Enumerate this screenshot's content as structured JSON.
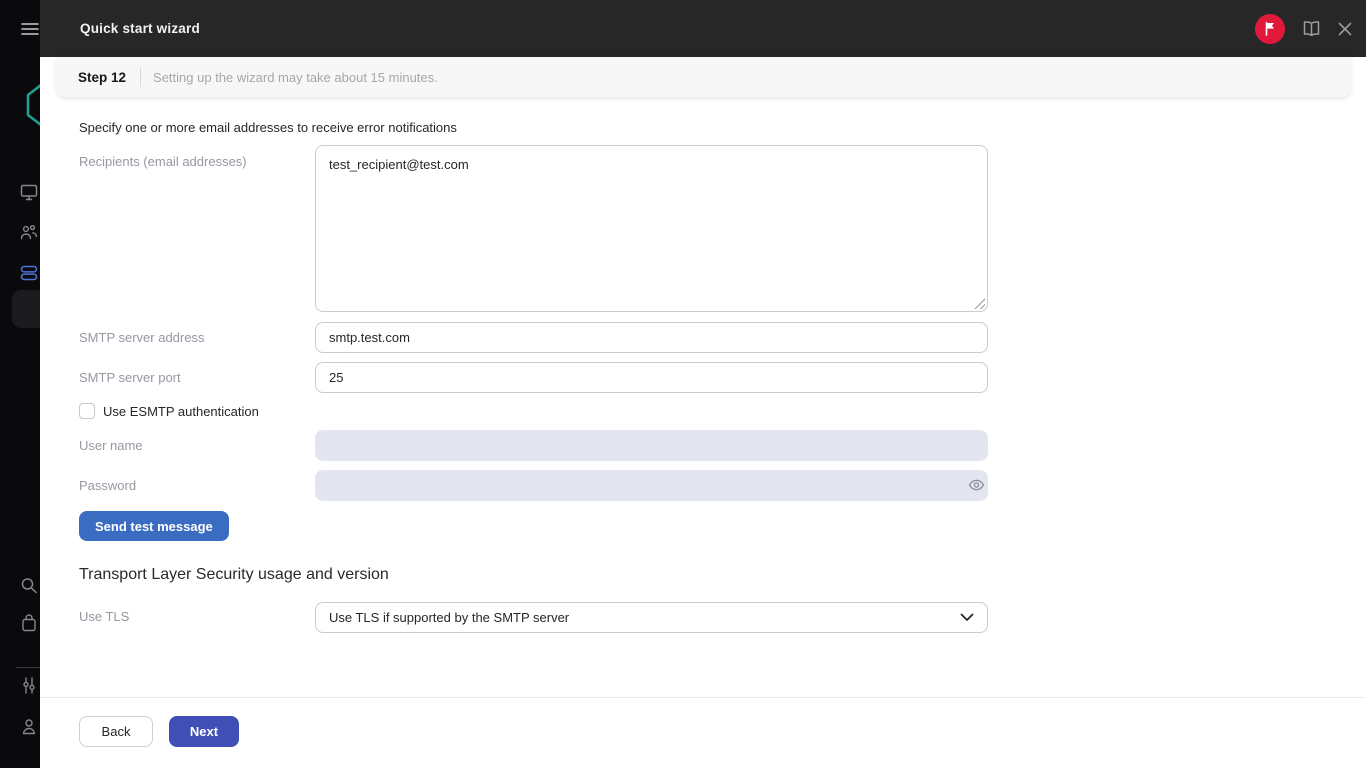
{
  "header": {
    "title": "Quick start wizard",
    "icons": {
      "whats_new": "flag-icon",
      "help": "book-icon",
      "close": "close-icon"
    }
  },
  "step_bar": {
    "step": "Step 12",
    "note": "Setting up the wizard may take about 15 minutes."
  },
  "form": {
    "intro": "Specify one or more email addresses to receive error notifications",
    "recipients": {
      "label": "Recipients (email addresses)",
      "value": "test_recipient@test.com"
    },
    "smtp_server_address": {
      "label": "SMTP server address",
      "value": "smtp.test.com"
    },
    "smtp_server_port": {
      "label": "SMTP server port",
      "value": "25"
    },
    "esmtp": {
      "label": "Use ESMTP authentication",
      "checked": false
    },
    "user_name": {
      "label": "User name",
      "value": "",
      "disabled": true
    },
    "password": {
      "label": "Password",
      "value": "",
      "disabled": true
    },
    "send_test_button": "Send test message",
    "tls": {
      "heading": "Transport Layer Security usage and version",
      "label": "Use TLS",
      "selected_option": "Use TLS if supported by the SMTP server"
    }
  },
  "footer": {
    "back": "Back",
    "next": "Next"
  },
  "sidebar": {
    "icons": [
      "menu-icon",
      "logo-hexagon",
      "monitor-icon",
      "users-icon",
      "servers-icon",
      "search-icon",
      "bag-icon",
      "sliders-icon",
      "person-icon"
    ],
    "active_icon": "servers-icon"
  },
  "colors": {
    "header_bg": "#272727",
    "sidebar_bg": "#0a0a0c",
    "accent_blue": "#3a6cc1",
    "accent_indigo": "#3f4fb5",
    "flag_red": "#e0193a",
    "logo_teal": "#1f9f8f",
    "disabled_field_bg": "#e3e6ef"
  }
}
